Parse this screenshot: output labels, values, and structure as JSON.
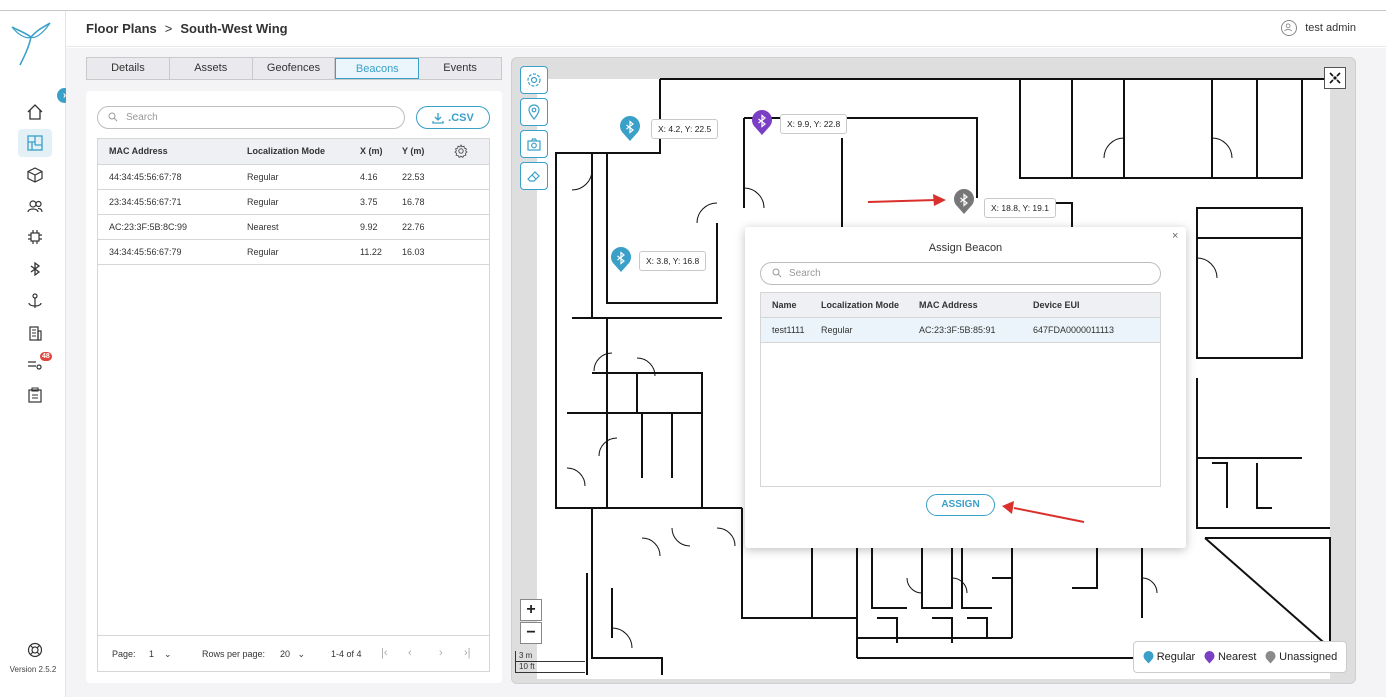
{
  "header": {
    "breadcrumb_root": "Floor Plans",
    "breadcrumb_current": "South-West Wing",
    "user_name": "test admin"
  },
  "sidebar": {
    "items": [
      "home-icon",
      "floor-plan-icon",
      "cube-icon",
      "users-icon",
      "chip-icon",
      "bluetooth-icon",
      "anchor-icon",
      "building-icon",
      "rules-icon",
      "reports-icon"
    ],
    "active_item": "floor-plan-icon",
    "badge_count": "48",
    "version": "Version 2.5.2"
  },
  "tabs": [
    {
      "label": "Details",
      "active": false
    },
    {
      "label": "Assets",
      "active": false
    },
    {
      "label": "Geofences",
      "active": false
    },
    {
      "label": "Beacons",
      "active": true
    },
    {
      "label": "Events",
      "active": false
    }
  ],
  "beacons_panel": {
    "search_placeholder": "Search",
    "csv_label": ".CSV",
    "columns": [
      "MAC Address",
      "Localization Mode",
      "X (m)",
      "Y (m)"
    ],
    "rows": [
      {
        "mac": "44:34:45:56:67:78",
        "mode": "Regular",
        "x": "4.16",
        "y": "22.53"
      },
      {
        "mac": "23:34:45:56:67:71",
        "mode": "Regular",
        "x": "3.75",
        "y": "16.78"
      },
      {
        "mac": "AC:23:3F:5B:8C:99",
        "mode": "Nearest",
        "x": "9.92",
        "y": "22.76"
      },
      {
        "mac": "34:34:45:56:67:79",
        "mode": "Regular",
        "x": "11.22",
        "y": "16.03"
      }
    ],
    "pager": {
      "page_label": "Page:",
      "page_value": "1",
      "rows_label": "Rows per page:",
      "rows_value": "20",
      "range": "1-4 of 4"
    }
  },
  "map": {
    "beacons": [
      {
        "label": "X: 4.2, Y: 22.5",
        "mode": "Regular"
      },
      {
        "label": "X: 9.9, Y: 22.8",
        "mode": "Nearest"
      },
      {
        "label": "X: 18.8, Y: 19.1",
        "mode": "Unassigned"
      },
      {
        "label": "X: 3.8, Y: 16.8",
        "mode": "Regular"
      }
    ],
    "scale_m": "3 m",
    "scale_ft": "10 ft",
    "zoom_in": "+",
    "zoom_out": "−",
    "legend": [
      {
        "label": "Regular",
        "color": "#3aa0c8"
      },
      {
        "label": "Nearest",
        "color": "#7b3fc4"
      },
      {
        "label": "Unassigned",
        "color": "#8a8a8a"
      }
    ]
  },
  "dialog": {
    "title": "Assign Beacon",
    "close": "×",
    "search_placeholder": "Search",
    "columns": [
      "Name",
      "Localization Mode",
      "MAC Address",
      "Device EUI"
    ],
    "rows": [
      {
        "name": "test1111",
        "mode": "Regular",
        "mac": "AC:23:3F:5B:85:91",
        "eui": "647FDA0000011113"
      }
    ],
    "assign_label": "ASSIGN"
  },
  "colors": {
    "accent": "#3aa0c8",
    "nearest": "#7b3fc4",
    "unassigned": "#8a8a8a",
    "annotation_arrow": "#d9302c"
  }
}
